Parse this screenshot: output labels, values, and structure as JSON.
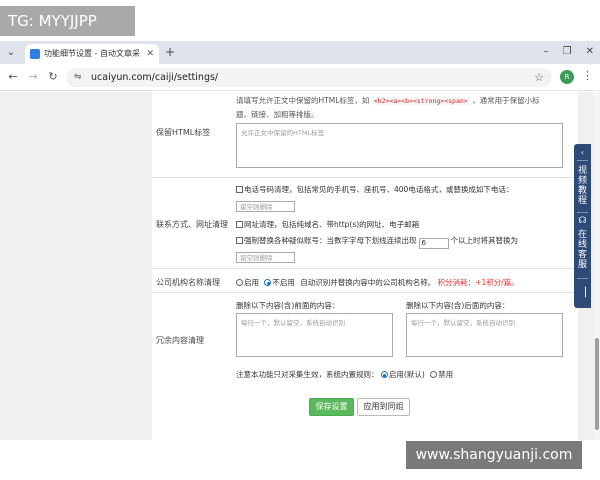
{
  "overlay": {
    "tg_badge": "TG: MYYJJPP",
    "watermark": "www.shangyuanji.com"
  },
  "browser": {
    "tab_title": "功能细节设置 - 自动文章采集...",
    "url": "ucaiyun.com/caiji/settings/",
    "profile_initial": "R"
  },
  "icons": {
    "tab_dropdown": "⌄",
    "tab_close": "✕",
    "new_tab": "+",
    "win_min": "–",
    "win_restore": "❐",
    "win_close": "✕",
    "back": "←",
    "forward": "→",
    "reload": "↻",
    "site_info": "⇋",
    "star": "☆",
    "menu": "⋮"
  },
  "form": {
    "html_tags": {
      "label": "保留HTML标签",
      "desc_prefix": "请填写允许正文中保留的HTML标签，如",
      "desc_code": "<h2><a><b><strong><span>",
      "desc_suffix": "，通常用于保留小标",
      "desc_line2": "题、链接、加粗等排版。",
      "placeholder": "允许正文中保留的HTML标签"
    },
    "contact": {
      "label": "联系方式、网址清理",
      "phone_option": "电话号码清理，包括常见的手机号、座机号、400电话格式，或替换成如下电话：",
      "phone_placeholder": "留空则删除",
      "url_option": "网址清理，包括纯域名、带http(s)的网址、电子邮箱",
      "force_option_prefix": "强制替换各种疑似账号：当数字字母下划线连续出现",
      "force_count": "6",
      "force_option_suffix": "个以上时将其替换为",
      "force_placeholder": "留空则删除"
    },
    "company": {
      "label": "公司机构名称清理",
      "opt_enable": "启用",
      "opt_disable": "不启用",
      "desc": "自动识别并替换内容中的公司机构名称。",
      "points": "积分消耗：+1积分/篇。"
    },
    "redundant": {
      "label": "冗余内容清理",
      "before_label": "删除以下内容(含)前面的内容：",
      "after_label": "删除以下内容(含)后面的内容：",
      "before_placeholder": "每行一个，默认留空，系统自动识别",
      "after_placeholder": "每行一个，默认留空，系统自动识别",
      "note": "注意本功能只对采集生效，系统内置规则：",
      "opt_default": "启用(默认)",
      "opt_disable": "禁用"
    },
    "buttons": {
      "save": "保存设置",
      "apply_group": "应用到同组"
    }
  },
  "side_float": {
    "video_tutorial": "视频教程",
    "online_service": "在线客服",
    "headset_icon": "headset-icon",
    "collapse": "▕"
  }
}
